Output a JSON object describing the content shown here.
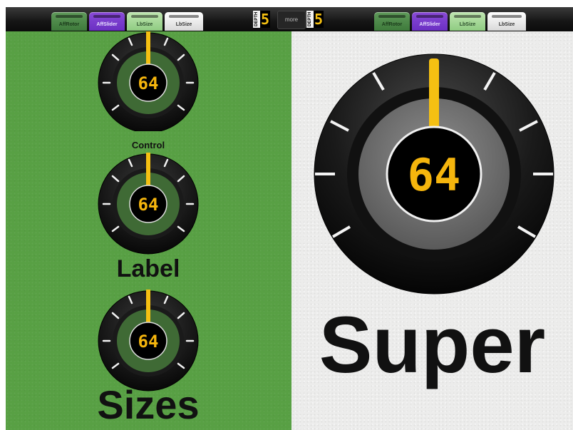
{
  "tabs_left": [
    {
      "label": "AffRotor",
      "style": "green"
    },
    {
      "label": "AffSlider",
      "style": "purple"
    },
    {
      "label": "LbSize",
      "style": "light-green"
    },
    {
      "label": "LbSize",
      "style": "white"
    }
  ],
  "tabs_right": [
    {
      "label": "AffRotor",
      "style": "green"
    },
    {
      "label": "AffSlider",
      "style": "purple"
    },
    {
      "label": "LbSize",
      "style": "light-green"
    },
    {
      "label": "LbSize",
      "style": "white"
    }
  ],
  "counters": [
    {
      "label": "DEPTH",
      "value": "5"
    },
    {
      "label": "DEPTH",
      "value": "5"
    }
  ],
  "more_label": "more",
  "knobs": [
    {
      "value": "64",
      "caption": ""
    },
    {
      "value": "64",
      "caption": "Control",
      "caption_position": "above"
    },
    {
      "value": "64",
      "caption": "Label"
    },
    {
      "value": "64",
      "caption": "Sizes"
    },
    {
      "value": "64",
      "caption": "Super"
    }
  ],
  "colors": {
    "left_background": "#58a044",
    "right_background": "#ececeb",
    "indicator": "#f5c012",
    "display_text": "#f5b50d"
  }
}
